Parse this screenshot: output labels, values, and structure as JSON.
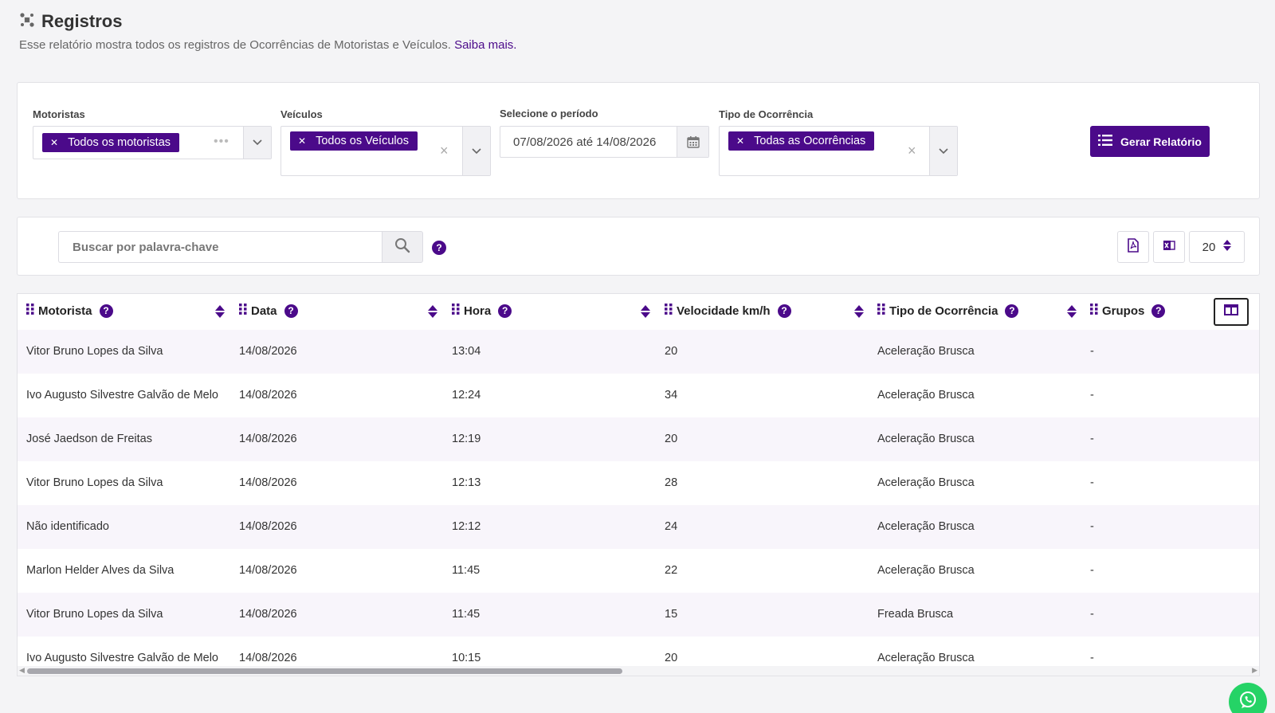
{
  "page": {
    "title": "Registros",
    "subtitle": "Esse relatório mostra todos os registros de Ocorrências de Motoristas e Veículos.",
    "learn_more": "Saiba mais."
  },
  "filters": {
    "drivers": {
      "label": "Motoristas",
      "tag": "Todos os motoristas"
    },
    "vehicles": {
      "label": "Veículos",
      "tag": "Todos os Veículos"
    },
    "period": {
      "label": "Selecione o período",
      "value": "07/08/2026  até  14/08/2026"
    },
    "occurrence": {
      "label": "Tipo de Ocorrência",
      "tag": "Todas as Ocorrências"
    },
    "generate_button": "Gerar Relatório"
  },
  "toolbar": {
    "search_placeholder": "Buscar por palavra-chave",
    "page_size": "20"
  },
  "table": {
    "columns": [
      "Motorista",
      "Data",
      "Hora",
      "Velocidade km/h",
      "Tipo de Ocorrência",
      "Grupos"
    ],
    "rows": [
      [
        "Vitor Bruno Lopes da Silva",
        "14/08/2026",
        "13:04",
        "20",
        "Aceleração Brusca",
        "-"
      ],
      [
        "Ivo Augusto Silvestre Galvão de Melo",
        "14/08/2026",
        "12:24",
        "34",
        "Aceleração Brusca",
        "-"
      ],
      [
        "José Jaedson de Freitas",
        "14/08/2026",
        "12:19",
        "20",
        "Aceleração Brusca",
        "-"
      ],
      [
        "Vitor Bruno Lopes da Silva",
        "14/08/2026",
        "12:13",
        "28",
        "Aceleração Brusca",
        "-"
      ],
      [
        "Não identificado",
        "14/08/2026",
        "12:12",
        "24",
        "Aceleração Brusca",
        "-"
      ],
      [
        "Marlon Helder Alves da Silva",
        "14/08/2026",
        "11:45",
        "22",
        "Aceleração Brusca",
        "-"
      ],
      [
        "Vitor Bruno Lopes da Silva",
        "14/08/2026",
        "11:45",
        "15",
        "Freada Brusca",
        "-"
      ],
      [
        "Ivo Augusto Silvestre Galvão de Melo",
        "14/08/2026",
        "10:15",
        "20",
        "Aceleração Brusca",
        "-"
      ]
    ]
  },
  "colors": {
    "accent": "#4b0a8a",
    "row_alt": "#f8f5fb",
    "whatsapp": "#25d366"
  },
  "icons": [
    "settings-icon",
    "chevron-down-icon",
    "calendar-icon",
    "list-icon",
    "search-icon",
    "help-icon",
    "pdf-icon",
    "excel-icon",
    "sort-icon",
    "drag-handle-icon",
    "columns-icon",
    "whatsapp-icon"
  ]
}
